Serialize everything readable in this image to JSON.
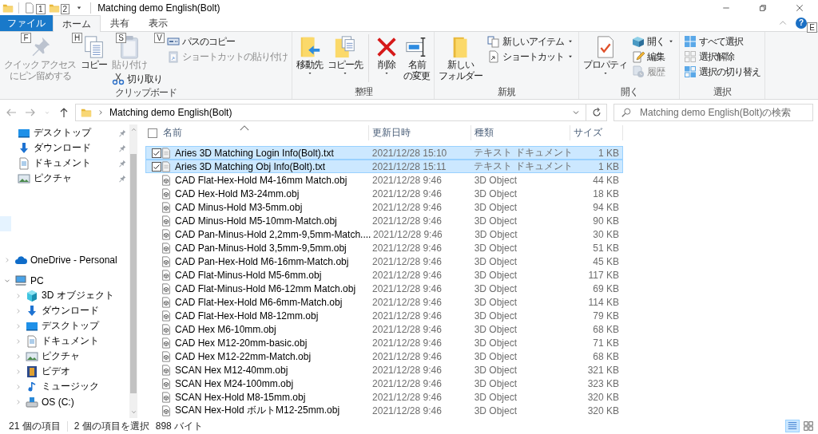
{
  "title_bar": {
    "title": "Matching demo English(Bolt)",
    "quick_access_key_tips": [
      "1",
      "2"
    ]
  },
  "ribbon_tabs": [
    {
      "label": "ファイル",
      "kind": "file",
      "selected": false,
      "key_tip": "F"
    },
    {
      "label": "ホーム",
      "kind": "tab",
      "selected": true,
      "key_tip": "H"
    },
    {
      "label": "共有",
      "kind": "tab",
      "selected": false,
      "key_tip": "S"
    },
    {
      "label": "表示",
      "kind": "tab",
      "selected": false,
      "key_tip": "V"
    }
  ],
  "help_button": {
    "label": "?",
    "key_tip": "E"
  },
  "ribbon_groups": [
    {
      "label": "クリップボード",
      "items": [
        {
          "kind": "large",
          "label_lines": [
            "クイック アクセス",
            "にピン留めする"
          ],
          "disabled": true,
          "has_menu": false
        },
        {
          "kind": "large",
          "label": "コピー",
          "disabled": false,
          "has_menu": false
        },
        {
          "kind": "stack",
          "items": [
            {
              "kind": "large",
              "label": "貼り付け",
              "disabled": true,
              "has_menu": false
            },
            {
              "kind": "small",
              "label": "切り取り",
              "disabled": false,
              "has_menu": false
            }
          ]
        },
        {
          "kind": "stack",
          "items": [
            {
              "kind": "small",
              "label": "パスのコピー",
              "disabled": false,
              "has_menu": false
            },
            {
              "kind": "small",
              "label": "ショートカットの貼り付け",
              "disabled": true,
              "has_menu": false
            }
          ]
        }
      ]
    },
    {
      "label": "整理",
      "items": [
        {
          "kind": "large",
          "label": "移動先",
          "disabled": false,
          "has_menu": true
        },
        {
          "kind": "large",
          "label": "コピー先",
          "disabled": false,
          "has_menu": true
        },
        {
          "kind": "separator"
        },
        {
          "kind": "large",
          "label": "削除",
          "disabled": false,
          "has_menu": true
        },
        {
          "kind": "large",
          "label_lines": [
            "名前",
            "の変更"
          ],
          "disabled": false,
          "has_menu": false
        }
      ]
    },
    {
      "label": "新規",
      "items": [
        {
          "kind": "large",
          "label_lines": [
            "新しい",
            "フォルダー"
          ],
          "disabled": false,
          "has_menu": false
        },
        {
          "kind": "stack",
          "items": [
            {
              "kind": "small",
              "label": "新しいアイテム",
              "disabled": false,
              "has_menu": true
            },
            {
              "kind": "small",
              "label": "ショートカット",
              "disabled": false,
              "has_menu": true
            }
          ]
        }
      ]
    },
    {
      "label": "開く",
      "items": [
        {
          "kind": "large",
          "label": "プロパティ",
          "disabled": false,
          "has_menu": true
        },
        {
          "kind": "stack",
          "items": [
            {
              "kind": "small",
              "label": "開く",
              "disabled": false,
              "has_menu": true
            },
            {
              "kind": "small",
              "label": "編集",
              "disabled": false,
              "has_menu": false
            },
            {
              "kind": "small",
              "label": "履歴",
              "disabled": true,
              "has_menu": false
            }
          ]
        }
      ]
    },
    {
      "label": "選択",
      "items": [
        {
          "kind": "stack",
          "items": [
            {
              "kind": "small",
              "label": "すべて選択",
              "disabled": false,
              "has_menu": false
            },
            {
              "kind": "small",
              "label": "選択解除",
              "disabled": false,
              "has_menu": false
            },
            {
              "kind": "small",
              "label": "選択の切り替え",
              "disabled": false,
              "has_menu": false
            }
          ]
        }
      ]
    }
  ],
  "address_bar": {
    "path": "Matching demo English(Bolt)"
  },
  "search": {
    "placeholder": "Matching demo English(Bolt)の検索"
  },
  "navigation": {
    "quick_access": [
      {
        "label": "デスクトップ",
        "kind": "desktop",
        "pinned": true
      },
      {
        "label": "ダウンロード",
        "kind": "download",
        "pinned": true
      },
      {
        "label": "ドキュメント",
        "kind": "document",
        "pinned": true
      },
      {
        "label": "ピクチャ",
        "kind": "picture",
        "pinned": true
      }
    ],
    "tree": [
      {
        "label": "OneDrive - Personal",
        "kind": "cloud",
        "expanded": false
      },
      {
        "label": "PC",
        "kind": "pc",
        "expanded": true,
        "children": [
          {
            "label": "3D オブジェクト",
            "kind": "object3d",
            "expanded": false
          },
          {
            "label": "ダウンロード",
            "kind": "download",
            "expanded": false
          },
          {
            "label": "デスクトップ",
            "kind": "desktop",
            "expanded": false
          },
          {
            "label": "ドキュメント",
            "kind": "document",
            "expanded": false
          },
          {
            "label": "ピクチャ",
            "kind": "picture",
            "expanded": false
          },
          {
            "label": "ビデオ",
            "kind": "video",
            "expanded": false
          },
          {
            "label": "ミュージック",
            "kind": "music",
            "expanded": false
          },
          {
            "label": "OS (C:)",
            "kind": "drive",
            "expanded": false
          }
        ]
      }
    ]
  },
  "file_list": {
    "select_all_checked": false,
    "columns": [
      {
        "label": "名前",
        "sorted": true
      },
      {
        "label": "更新日時",
        "sorted": false
      },
      {
        "label": "種類",
        "sorted": false
      },
      {
        "label": "サイズ",
        "sorted": false
      }
    ],
    "files": [
      {
        "name": "Aries 3D Matching Login Info(Bolt).txt",
        "modified": "2021/12/28 15:10",
        "type": "テキスト ドキュメント",
        "size": "1 KB",
        "kind": "text",
        "selected": true,
        "checked": true
      },
      {
        "name": "Aries 3D Matching Obj Info(Bolt).txt",
        "modified": "2021/12/28 15:11",
        "type": "テキスト ドキュメント",
        "size": "1 KB",
        "kind": "text",
        "selected": true,
        "checked": true
      },
      {
        "name": "CAD Flat-Hex-Hold M4-16mm Match.obj",
        "modified": "2021/12/28 9:46",
        "type": "3D Object",
        "size": "44 KB",
        "kind": "object",
        "selected": false,
        "checked": false
      },
      {
        "name": "CAD Hex-Hold M3-24mm.obj",
        "modified": "2021/12/28 9:46",
        "type": "3D Object",
        "size": "18 KB",
        "kind": "object",
        "selected": false,
        "checked": false
      },
      {
        "name": "CAD Minus-Hold M3-5mm.obj",
        "modified": "2021/12/28 9:46",
        "type": "3D Object",
        "size": "94 KB",
        "kind": "object",
        "selected": false,
        "checked": false
      },
      {
        "name": "CAD Minus-Hold M5-10mm-Match.obj",
        "modified": "2021/12/28 9:46",
        "type": "3D Object",
        "size": "90 KB",
        "kind": "object",
        "selected": false,
        "checked": false
      },
      {
        "name": "CAD Pan-Minus-Hold 2,2mm-9,5mm-Match....",
        "modified": "2021/12/28 9:46",
        "type": "3D Object",
        "size": "30 KB",
        "kind": "object",
        "selected": false,
        "checked": false
      },
      {
        "name": "CAD Pan-Minus-Hold 3,5mm-9,5mm.obj",
        "modified": "2021/12/28 9:46",
        "type": "3D Object",
        "size": "51 KB",
        "kind": "object",
        "selected": false,
        "checked": false
      },
      {
        "name": "CAD Pan-Hex-Hold M6-16mm-Match.obj",
        "modified": "2021/12/28 9:46",
        "type": "3D Object",
        "size": "45 KB",
        "kind": "object",
        "selected": false,
        "checked": false
      },
      {
        "name": "CAD Flat-Minus-Hold M5-6mm.obj",
        "modified": "2021/12/28 9:46",
        "type": "3D Object",
        "size": "117 KB",
        "kind": "object",
        "selected": false,
        "checked": false
      },
      {
        "name": "CAD Flat-Minus-Hold M6-12mm Match.obj",
        "modified": "2021/12/28 9:46",
        "type": "3D Object",
        "size": "69 KB",
        "kind": "object",
        "selected": false,
        "checked": false
      },
      {
        "name": "CAD Flat-Hex-Hold M6-6mm-Match.obj",
        "modified": "2021/12/28 9:46",
        "type": "3D Object",
        "size": "114 KB",
        "kind": "object",
        "selected": false,
        "checked": false
      },
      {
        "name": "CAD Flat-Hex-Hold M8-12mm.obj",
        "modified": "2021/12/28 9:46",
        "type": "3D Object",
        "size": "79 KB",
        "kind": "object",
        "selected": false,
        "checked": false
      },
      {
        "name": "CAD Hex M6-10mm.obj",
        "modified": "2021/12/28 9:46",
        "type": "3D Object",
        "size": "68 KB",
        "kind": "object",
        "selected": false,
        "checked": false
      },
      {
        "name": "CAD Hex M12-20mm-basic.obj",
        "modified": "2021/12/28 9:46",
        "type": "3D Object",
        "size": "71 KB",
        "kind": "object",
        "selected": false,
        "checked": false
      },
      {
        "name": "CAD Hex M12-22mm-Match.obj",
        "modified": "2021/12/28 9:46",
        "type": "3D Object",
        "size": "68 KB",
        "kind": "object",
        "selected": false,
        "checked": false
      },
      {
        "name": "SCAN Hex M12-40mm.obj",
        "modified": "2021/12/28 9:46",
        "type": "3D Object",
        "size": "321 KB",
        "kind": "object",
        "selected": false,
        "checked": false
      },
      {
        "name": "SCAN Hex M24-100mm.obj",
        "modified": "2021/12/28 9:46",
        "type": "3D Object",
        "size": "323 KB",
        "kind": "object",
        "selected": false,
        "checked": false
      },
      {
        "name": "SCAN Hex-Hold M8-15mm.obj",
        "modified": "2021/12/28 9:46",
        "type": "3D Object",
        "size": "320 KB",
        "kind": "object",
        "selected": false,
        "checked": false
      },
      {
        "name": "SCAN Hex-Hold ボルトM12-25mm.obj",
        "modified": "2021/12/28 9:46",
        "type": "3D Object",
        "size": "320 KB",
        "kind": "object",
        "selected": false,
        "checked": false
      }
    ]
  },
  "status_bar": {
    "item_count": "21 個の項目",
    "selection": "2 個の項目を選択",
    "selection_size": "898 バイト",
    "views": [
      {
        "kind": "details",
        "selected": true
      },
      {
        "kind": "large_icons",
        "selected": false
      }
    ]
  }
}
